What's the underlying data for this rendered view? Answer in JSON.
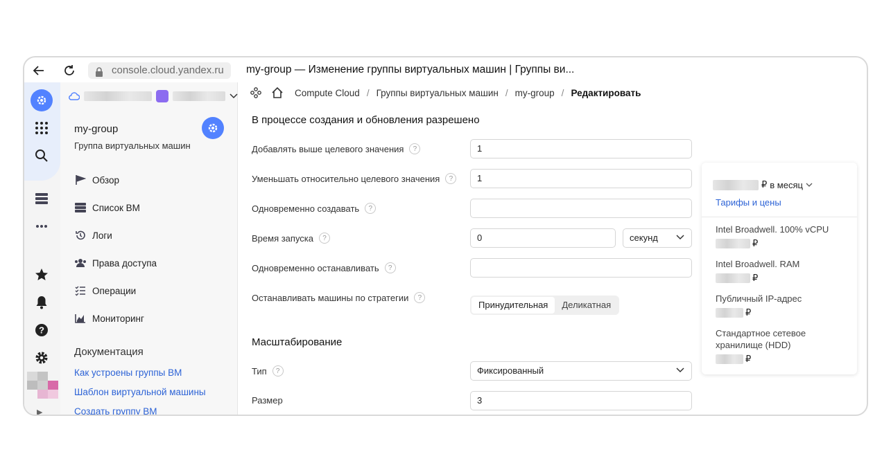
{
  "browser": {
    "url": "console.cloud.yandex.ru",
    "tab_title": "my-group — Изменение группы виртуальных машин | Группы ви..."
  },
  "sidebar": {
    "title": "my-group",
    "subtitle": "Группа виртуальных машин",
    "items": [
      {
        "label": "Обзор",
        "icon": "flag-icon"
      },
      {
        "label": "Список ВМ",
        "icon": "server-list-icon"
      },
      {
        "label": "Логи",
        "icon": "history-icon"
      },
      {
        "label": "Права доступа",
        "icon": "users-icon"
      },
      {
        "label": "Операции",
        "icon": "checklist-icon"
      },
      {
        "label": "Мониторинг",
        "icon": "chart-icon"
      }
    ],
    "docs_title": "Документация",
    "doc_links": [
      "Как устроены группы ВМ",
      "Шаблон виртуальной машины",
      "Создать группу ВМ"
    ]
  },
  "breadcrumbs": [
    "Compute Cloud",
    "Группы виртуальных машин",
    "my-group",
    "Редактировать"
  ],
  "form": {
    "section1_title": "В процессе создания и обновления разрешено",
    "fields": [
      {
        "label": "Добавлять выше целевого значения",
        "value": "1"
      },
      {
        "label": "Уменьшать относительно целевого значения",
        "value": "1"
      },
      {
        "label": "Одновременно создавать",
        "value": ""
      },
      {
        "label": "Время запуска",
        "value": "0",
        "unit": "секунд"
      },
      {
        "label": "Одновременно останавливать",
        "value": ""
      }
    ],
    "strategy_label": "Останавливать машины по стратегии",
    "strategy_options": [
      "Принудительная",
      "Деликатная"
    ],
    "strategy_selected": "Принудительная",
    "section2_title": "Масштабирование",
    "type_label": "Тип",
    "type_value": "Фиксированный",
    "size_label": "Размер",
    "size_value": "3"
  },
  "price_card": {
    "currency": "₽",
    "period": "в месяц",
    "link": "Тарифы и цены",
    "items": [
      {
        "label": "Intel Broadwell. 100% vCPU"
      },
      {
        "label": "Intel Broadwell. RAM"
      },
      {
        "label": "Публичный IP-адрес"
      },
      {
        "label": "Стандартное сетевое хранилище (HDD)"
      }
    ]
  },
  "colors": {
    "accent": "#5282ff",
    "link": "#2d63d6"
  }
}
